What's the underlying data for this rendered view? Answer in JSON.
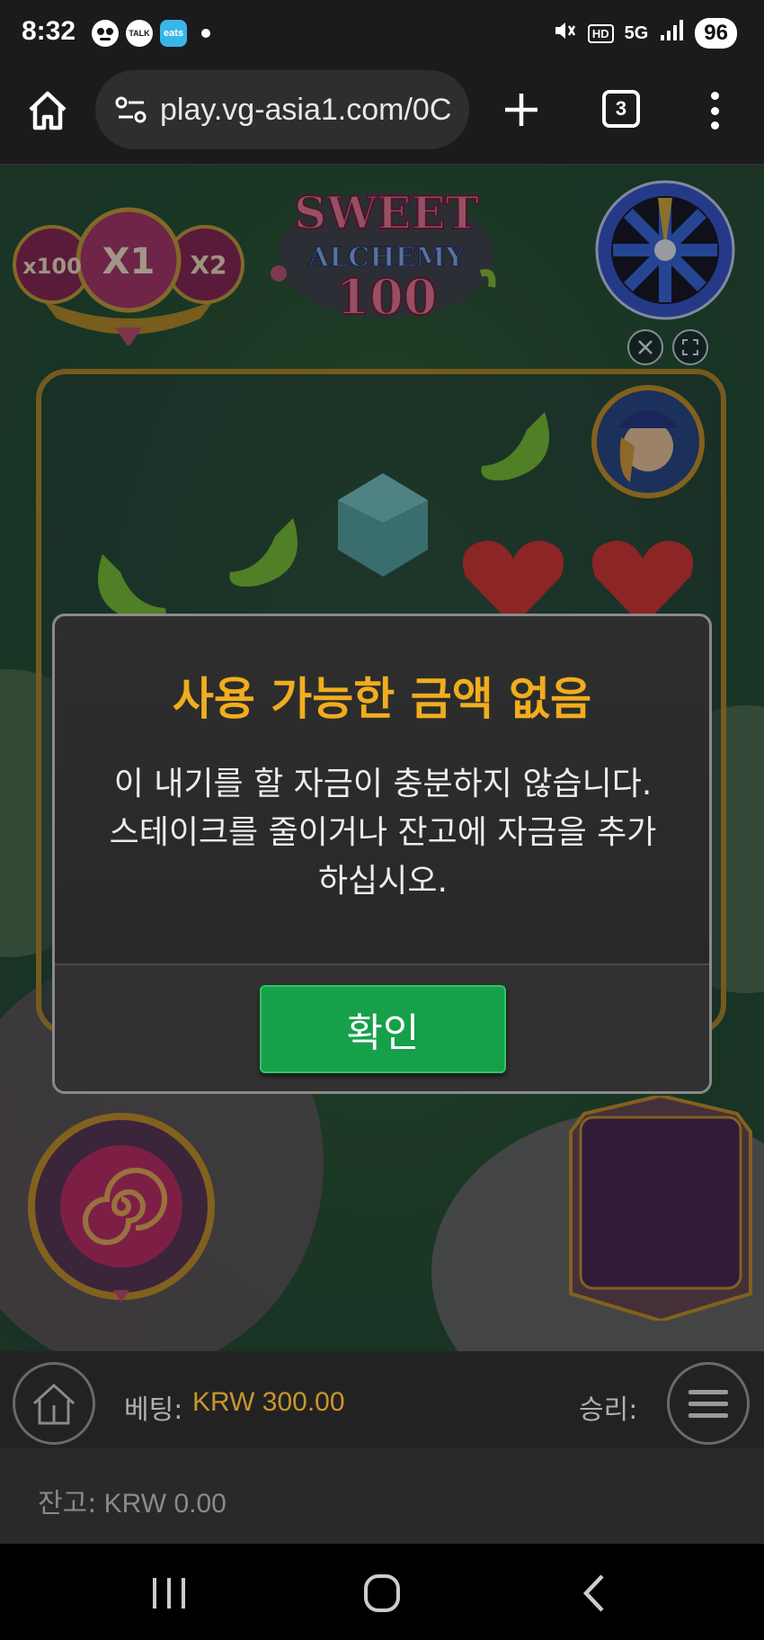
{
  "status_bar": {
    "time": "8:32",
    "app_icons": [
      "face-icon",
      "talk-icon",
      "eats-icon"
    ],
    "talk_label": "TALK",
    "eats_label": "eats",
    "hd_label": "HD",
    "network_label": "5G",
    "battery": "96"
  },
  "browser": {
    "url": "play.vg-asia1.com/0C",
    "tab_count": "3"
  },
  "game": {
    "name": "Sweet Alchemy 100",
    "multipliers": [
      "x100",
      "X1",
      "X2"
    ]
  },
  "dialog": {
    "title": "사용 가능한 금액 없음",
    "message_line1": "이 내기를 할 자금이 충분하지 않습니다.",
    "message_line2": "스테이크를 줄이거나 잔고에 자금을 추가",
    "message_line3": "하십시오.",
    "confirm_label": "확인"
  },
  "game_bar": {
    "bet_label": "베팅:",
    "bet_value": "KRW 300.00",
    "win_label": "승리:",
    "balance_label": "잔고:",
    "balance_value": "KRW 0.00"
  },
  "colors": {
    "title_accent": "#f0ad1e",
    "confirm_green": "#16a04a",
    "bet_value": "#c8962e"
  }
}
